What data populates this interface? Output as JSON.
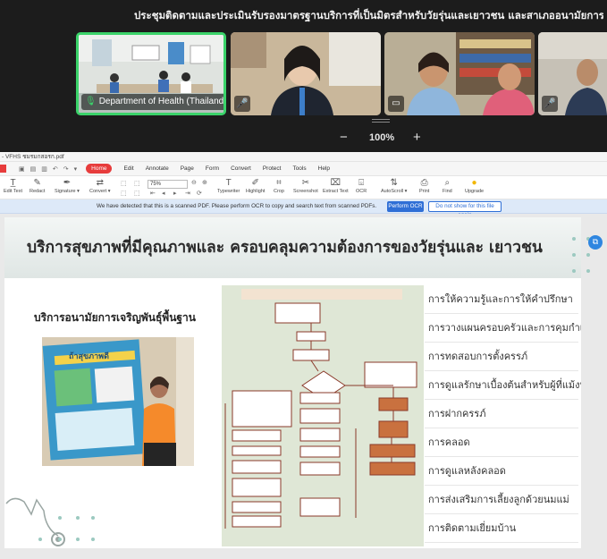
{
  "meeting": {
    "title": "ประชุมติดตามและประเมินรับรองมาตรฐานบริการที่เป็นมิตรสำหรับวัยรุ่นและเยาวชน และสาเภออนามัยการเจริญพันธุ์ เขตสุขภาพที่",
    "tiles": [
      {
        "name": "Department of Health (Thailand...",
        "muted": false
      },
      {
        "name": "",
        "muted": true
      },
      {
        "name": "",
        "muted": false
      },
      {
        "name": "",
        "muted": true
      }
    ],
    "zoom": "100%",
    "zoom_minus": "−",
    "zoom_plus": "+"
  },
  "pdf": {
    "window_title": "- VFHS ชมรมกสอรก.pdf",
    "menu": [
      "Home",
      "Edit",
      "Annotate",
      "Page",
      "Form",
      "Convert",
      "Protect",
      "Tools",
      "Help"
    ],
    "toolbar": {
      "edit_text": "Edit Text",
      "redact": "Redact",
      "signature": "Signature ▾",
      "convert": "Convert ▾",
      "zoom_value": "75%",
      "typewriter": "Typewriter",
      "highlight": "Highlight",
      "crop": "Crop",
      "screenshot": "Screenshot",
      "extract_text": "Extract Text",
      "ocr": "OCR",
      "autoscroll": "AutoScroll ▾",
      "print": "Print",
      "find": "Find",
      "upgrade": "Upgrade"
    },
    "ocr_bar": {
      "message": "We have detected that this is a scanned PDF. Please perform OCR to copy and search text from scanned PDFs.",
      "perform_button": "Perform OCR",
      "dismiss_button": "Do not show for this file again"
    }
  },
  "slide": {
    "title": "บริการสุขภาพที่มีคุณภาพและ ครอบคลุมความต้องการของวัยรุ่นและ เยาวชน",
    "subtitle": "บริการอนามัยการเจริญพันธุ์พื้นฐาน",
    "poster_text": "ถ้าสุขภาพดี",
    "services": [
      "การให้ความรู้และการให้คำปรึกษา",
      "การวางแผนครอบครัวและการคุมกำเนิด",
      "การทดสอบการตั้งครรภ์",
      "การดูแลรักษาเบื้องต้นสำหรับผู้ที่แม้งบุตร",
      "การฝากครรภ์",
      "การคลอด",
      "การดูแลหลังคลอด",
      "การส่งเสริมการเลี้ยงลูกด้วยนมแม่",
      "การติดตามเยี่ยมบ้าน"
    ]
  },
  "colors": {
    "accent": "#e73c3c",
    "meeting_bg": "#1c1c1c",
    "active_speaker": "#3bd36a",
    "ocr_button": "#2f6fd6"
  }
}
